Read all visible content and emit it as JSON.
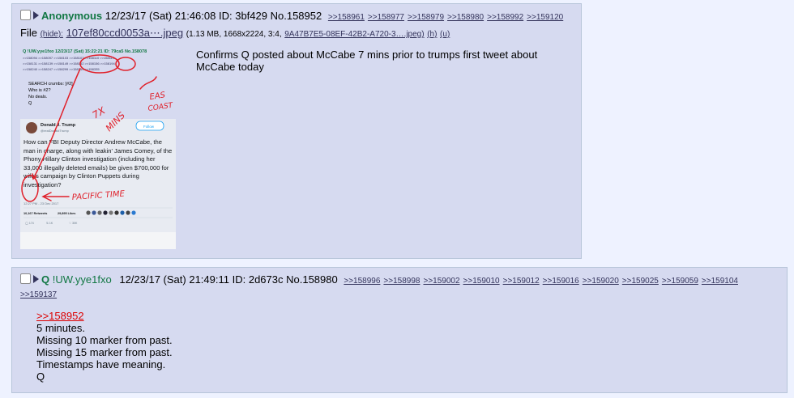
{
  "post1": {
    "name": "Anonymous",
    "datetime": "12/23/17 (Sat) 21:46:08",
    "id": "ID: 3bf429",
    "no": "No.158952",
    "backlinks": [
      ">>158961",
      ">>158977",
      ">>158979",
      ">>158980",
      ">>158992",
      ">>159120"
    ],
    "file_label": "File",
    "hide": "(hide):",
    "filename": "107ef80ccd0053a⋯.jpeg",
    "fileinfo": "(1.13 MB, 1668x2224, 3:4,",
    "filehash": "9A47B7E5-08EF-42B2-A720-3….jpeg)",
    "h": "(h)",
    "u": "(u)",
    "message": "Confirms Q posted about McCabe 7 mins prior to trumps first tweet about McCabe today",
    "thumbnail": {
      "embedded_q_post_header": "Q !UW.yye1fxo 12/23/17 (Sat) 15:22:21 ID: 79ca5 No.158078",
      "embedded_q_crumbs": [
        "SEARCH crumbs: [#2]",
        "Who is #2?",
        "No deals.",
        "Q"
      ],
      "tweet_author": "Donald J. Trump",
      "tweet_handle": "@realDonaldTrump",
      "tweet_follow": "Follow",
      "tweet_text": "How can FBI Deputy Director Andrew McCabe, the man in charge, along with leakin' James Comey, of the Phony Hillary Clinton investigation (including her 33,000 illegally deleted emails) be given $700,000 for wife's campaign by Clinton Puppets during investigation?",
      "tweet_time": "12:27 PM - 23 Dec 2017",
      "tweet_retweets": "10,167 Retweets",
      "tweet_likes": "29,895 Likes",
      "annot_eas": "EAS",
      "annot_coast": "COAST",
      "annot_7x": "7X",
      "annot_mins": "MINS",
      "annot_pacific": "PACIFIC TIME"
    }
  },
  "post2": {
    "name": "Q",
    "trip": "!UW.yye1fxo",
    "datetime": "12/23/17 (Sat) 21:49:11",
    "id": "ID: 2d673c",
    "no": "No.158980",
    "backlinks": [
      ">>158996",
      ">>158998",
      ">>159002",
      ">>159010",
      ">>159012",
      ">>159016",
      ">>159020",
      ">>159025",
      ">>159059",
      ">>159104"
    ],
    "backlinks_line2": [
      ">>159137"
    ],
    "quote": ">>158952",
    "lines": [
      "5 minutes.",
      "Missing 10 marker from past.",
      "Missing 15 marker from past.",
      "Timestamps have meaning.",
      "Q"
    ]
  }
}
